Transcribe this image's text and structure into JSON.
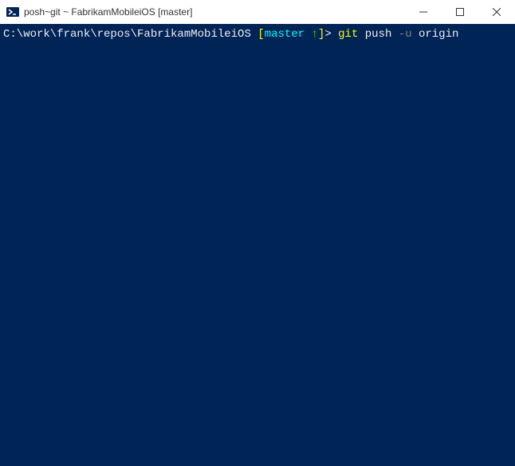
{
  "window": {
    "title": "posh~git ~ FabrikamMobileiOS [master]"
  },
  "prompt": {
    "path": "C:\\work\\frank\\repos\\FabrikamMobileiOS",
    "bracket_open": " [",
    "branch": "master",
    "arrow": " ↑",
    "bracket_close": "]",
    "symbol": "> "
  },
  "command": {
    "git": "git",
    "subcommand": " push ",
    "flag": "-u",
    "arg": " origin"
  }
}
